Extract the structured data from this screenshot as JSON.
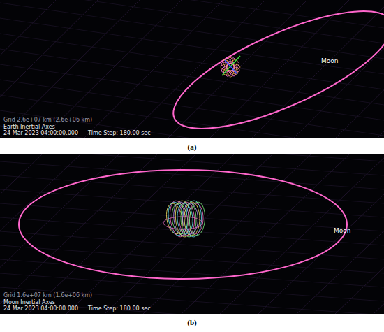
{
  "figure": {
    "panels": [
      {
        "caption": "(a)",
        "moon_label": "Moon",
        "grid": "Grid 2.6e+07 km (2.6e+06 km)",
        "axes": "Earth Inertial Axes",
        "date": "24 Mar 2023 04:00:00.000",
        "time_step": "Time Step: 180.00 sec"
      },
      {
        "caption": "(b)",
        "moon_label": "Moon",
        "grid": "Grid 1.6e+07 km (1.6e+06 km)",
        "axes": "Moon Inertial Axes",
        "date": "24 Mar 2023 04:00:00.000",
        "time_step": "Time Step: 180.00 sec"
      }
    ]
  }
}
